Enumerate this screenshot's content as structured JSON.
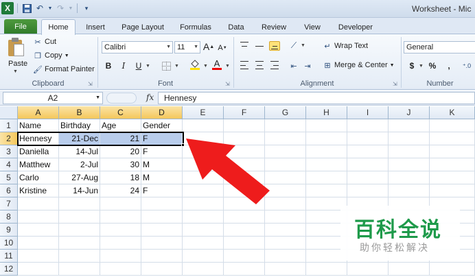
{
  "window": {
    "title": "Worksheet - Mic"
  },
  "tabs": [
    {
      "label": "File"
    },
    {
      "label": "Home"
    },
    {
      "label": "Insert"
    },
    {
      "label": "Page Layout"
    },
    {
      "label": "Formulas"
    },
    {
      "label": "Data"
    },
    {
      "label": "Review"
    },
    {
      "label": "View"
    },
    {
      "label": "Developer"
    }
  ],
  "ribbon": {
    "clipboard": {
      "paste": "Paste",
      "cut": "Cut",
      "copy": "Copy",
      "format_painter": "Format Painter",
      "label": "Clipboard"
    },
    "font": {
      "name": "Calibri",
      "size": "11",
      "grow": "A",
      "shrink": "A",
      "bold": "B",
      "italic": "I",
      "underline": "U",
      "font_color": "A",
      "label": "Font"
    },
    "alignment": {
      "wrap_text": "Wrap Text",
      "merge_center": "Merge & Center",
      "label": "Alignment"
    },
    "number": {
      "format": "General",
      "currency": "$",
      "percent": "%",
      "comma": ",",
      "label": "Number"
    }
  },
  "formula_bar": {
    "name_box": "A2",
    "fx": "fx",
    "value": "Hennesy"
  },
  "grid": {
    "columns": [
      "A",
      "B",
      "C",
      "D",
      "E",
      "F",
      "G",
      "H",
      "I",
      "J",
      "K"
    ],
    "rows": [
      "1",
      "2",
      "3",
      "4",
      "5",
      "6",
      "7",
      "8",
      "9",
      "10",
      "11",
      "12"
    ],
    "data": [
      [
        "Name",
        "Birthday",
        "Age",
        "Gender"
      ],
      [
        "Hennesy",
        "21-Dec",
        "21",
        "F"
      ],
      [
        "Daniella",
        "14-Jul",
        "20",
        "F"
      ],
      [
        "Matthew",
        "2-Jul",
        "30",
        "M"
      ],
      [
        "Carlo",
        "27-Aug",
        "18",
        "M"
      ],
      [
        "Kristine",
        "14-Jun",
        "24",
        "F"
      ]
    ]
  },
  "watermark": {
    "top": "百科全说",
    "bottom": "助你轻松解决"
  },
  "colors": {
    "file_tab": "#2f7a2a",
    "selection": "#b9cdec",
    "arrow": "#ee1c1c",
    "watermark": "#1e9a4a"
  }
}
